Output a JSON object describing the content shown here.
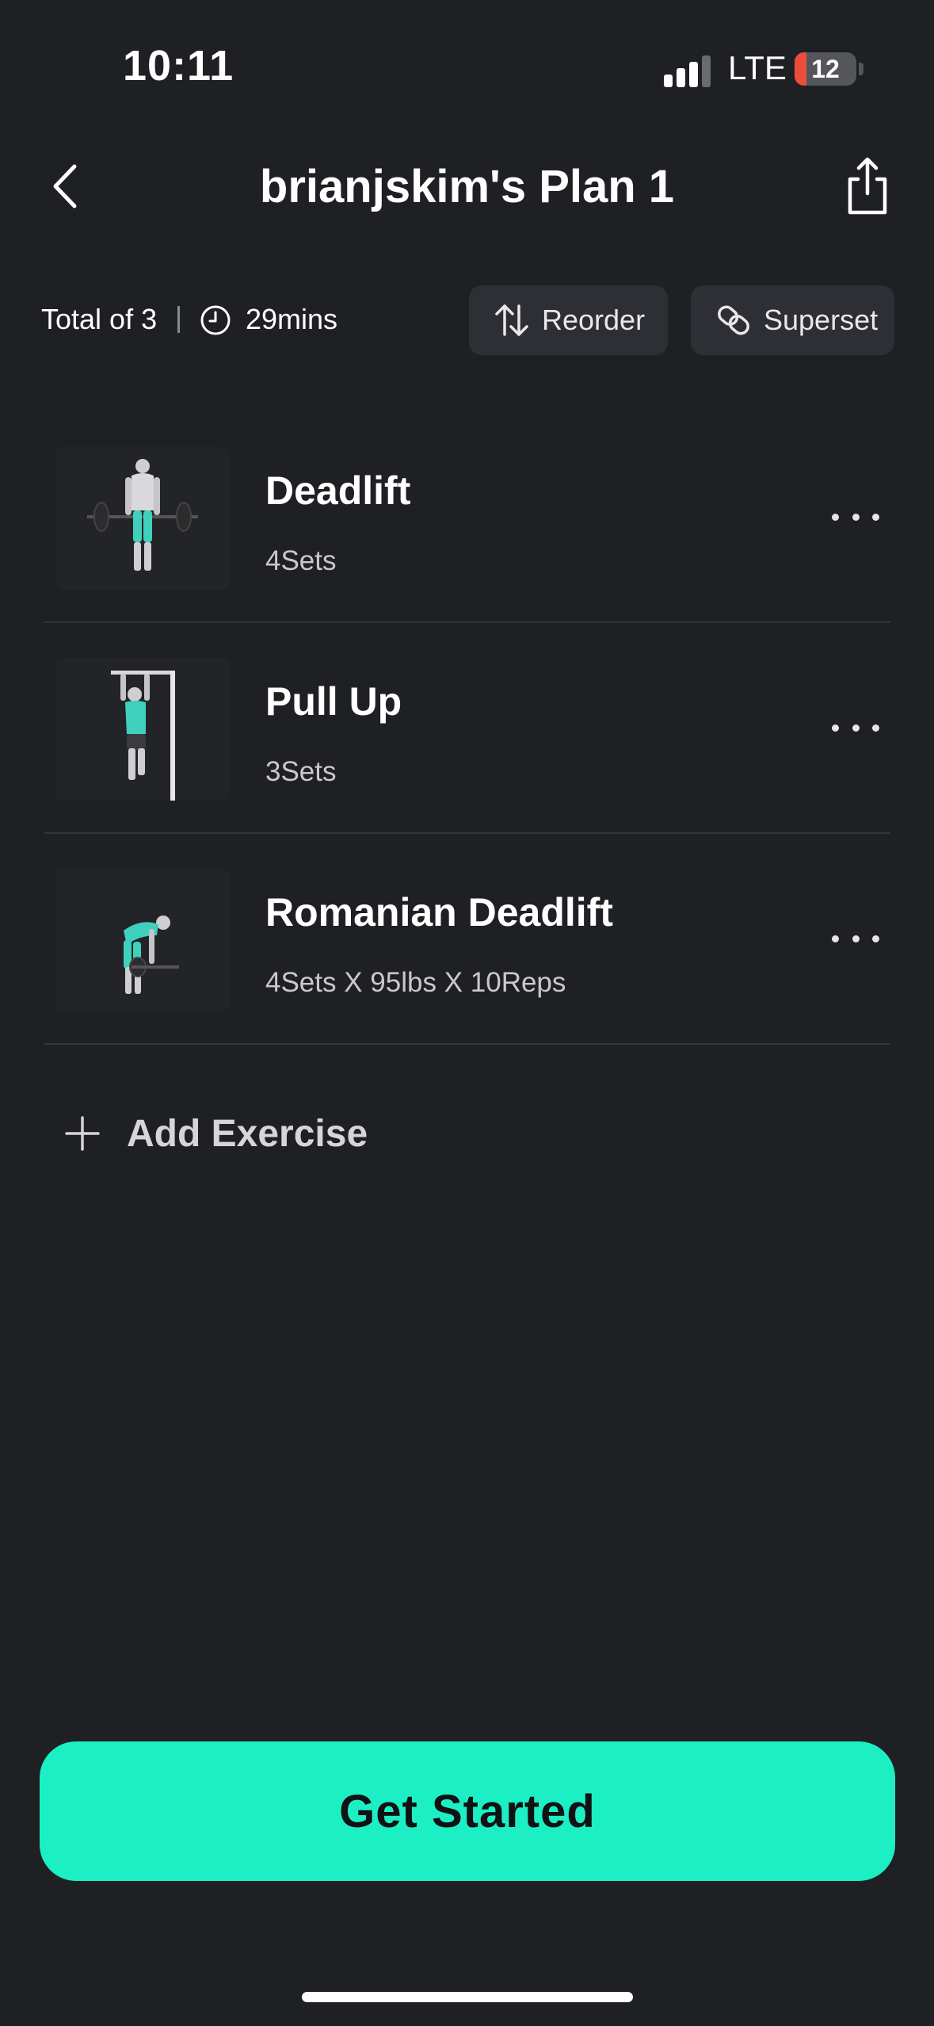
{
  "status_bar": {
    "time": "10:11",
    "network": "LTE",
    "battery_level": "12",
    "battery_fraction": 0.12,
    "battery_color": "#eb4d3d"
  },
  "header": {
    "title": "brianjskim's Plan 1",
    "back_icon": "chevron-left-icon",
    "share_icon": "share-icon"
  },
  "summary": {
    "total": "Total of 3",
    "duration": "29mins"
  },
  "toolbar": {
    "reorder_label": "Reorder",
    "superset_label": "Superset"
  },
  "exercises": [
    {
      "name": "Deadlift",
      "detail": "4Sets"
    },
    {
      "name": "Pull Up",
      "detail": "3Sets"
    },
    {
      "name": "Romanian Deadlift",
      "detail": "4Sets X 95lbs X 10Reps"
    }
  ],
  "add_exercise_label": "Add Exercise",
  "cta": {
    "label": "Get Started",
    "color": "#1cefc4"
  },
  "colors": {
    "background": "#1f2024",
    "accent": "#1cefc4",
    "muscle_highlight": "#3fd1bd"
  }
}
